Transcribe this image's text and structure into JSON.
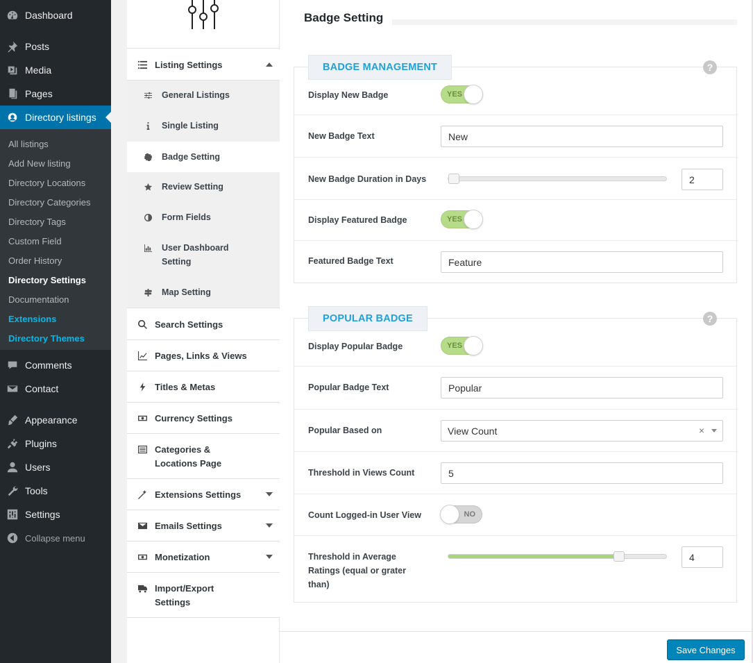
{
  "wp_menu": {
    "items": [
      {
        "label": "Dashboard",
        "icon": "dashboard-icon"
      },
      {
        "label": "Posts",
        "icon": "pin-icon"
      },
      {
        "label": "Media",
        "icon": "media-icon"
      },
      {
        "label": "Pages",
        "icon": "pages-icon"
      },
      {
        "label": "Directory listings",
        "icon": "directory-icon"
      },
      {
        "label": "Comments",
        "icon": "comment-icon"
      },
      {
        "label": "Contact",
        "icon": "mail-icon"
      },
      {
        "label": "Appearance",
        "icon": "brush-icon"
      },
      {
        "label": "Plugins",
        "icon": "plug-icon"
      },
      {
        "label": "Users",
        "icon": "user-icon"
      },
      {
        "label": "Tools",
        "icon": "wrench-icon"
      },
      {
        "label": "Settings",
        "icon": "sliders-icon"
      }
    ],
    "submenu": [
      "All listings",
      "Add New listing",
      "Directory Locations",
      "Directory Categories",
      "Directory Tags",
      "Custom Field",
      "Order History",
      "Directory Settings",
      "Documentation",
      "Extensions",
      "Directory Themes"
    ],
    "collapse_label": "Collapse menu"
  },
  "settings_nav": {
    "listing_settings": "Listing Settings",
    "sub_items": [
      {
        "label": "General Listings",
        "icon": "sliders-icon"
      },
      {
        "label": "Single Listing",
        "icon": "info-icon"
      },
      {
        "label": "Badge Setting",
        "icon": "badge-icon"
      },
      {
        "label": "Review Setting",
        "icon": "star-icon"
      },
      {
        "label": "Form Fields",
        "icon": "half-circle-icon"
      },
      {
        "label": "User Dashboard",
        "label2": "Setting",
        "icon": "bar-chart-icon"
      },
      {
        "label": "Map Setting",
        "icon": "signpost-icon"
      }
    ],
    "items": [
      {
        "label": "Search Settings",
        "icon": "search-icon"
      },
      {
        "label": "Pages, Links & Views",
        "icon": "line-chart-icon"
      },
      {
        "label": "Titles & Metas",
        "icon": "bolt-icon"
      },
      {
        "label": "Currency Settings",
        "icon": "money-icon"
      },
      {
        "label": "Categories &",
        "label2": "Locations Page",
        "icon": "list-icon"
      },
      {
        "label": "Extensions Settings",
        "icon": "wand-icon"
      },
      {
        "label": "Emails Settings",
        "icon": "envelope-icon"
      },
      {
        "label": "Monetization",
        "icon": "money-icon"
      },
      {
        "label": "Import/Export",
        "label2": "Settings",
        "icon": "truck-icon"
      }
    ]
  },
  "main": {
    "title": "Badge Setting",
    "badge_management": {
      "heading": "BADGE MANAGEMENT",
      "help": "?",
      "display_new_badge_label": "Display New Badge",
      "display_new_badge_state": "YES",
      "new_badge_text_label": "New Badge Text",
      "new_badge_text_value": "New",
      "new_badge_duration_label": "New Badge Duration in Days",
      "new_badge_duration_value": "2",
      "new_badge_duration_fraction": 0.0,
      "display_featured_badge_label": "Display Featured Badge",
      "display_featured_badge_state": "YES",
      "featured_badge_text_label": "Featured Badge Text",
      "featured_badge_text_value": "Feature"
    },
    "popular_badge": {
      "heading": "POPULAR BADGE",
      "help": "?",
      "display_popular_badge_label": "Display Popular Badge",
      "display_popular_badge_state": "YES",
      "popular_badge_text_label": "Popular Badge Text",
      "popular_badge_text_value": "Popular",
      "popular_based_on_label": "Popular Based on",
      "popular_based_on_value": "View Count",
      "clear_symbol": "×",
      "threshold_views_label": "Threshold in Views Count",
      "threshold_views_value": "5",
      "count_logged_in_label": "Count Logged-in User View",
      "count_logged_in_state": "NO",
      "threshold_avg_label_1": "Threshold in Average",
      "threshold_avg_label_2": "Ratings (equal or grater",
      "threshold_avg_label_3": "than)",
      "threshold_avg_value": "4",
      "threshold_avg_fraction": 0.8
    },
    "save_label": "Save Changes"
  }
}
